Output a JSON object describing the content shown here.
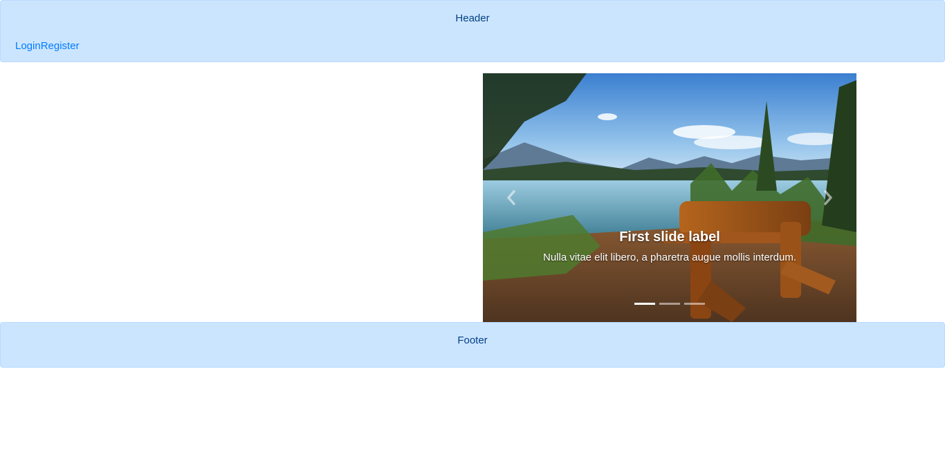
{
  "header": {
    "title": "Header",
    "nav": {
      "login_label": "Login",
      "register_label": "Register"
    }
  },
  "carousel": {
    "active_index": 0,
    "slide_count": 3,
    "slides": [
      {
        "caption_title": "First slide label",
        "caption_text": "Nulla vitae elit libero, a pharetra augue mollis interdum."
      }
    ],
    "prev_icon": "chevron-left-icon",
    "next_icon": "chevron-right-icon"
  },
  "footer": {
    "title": "Footer"
  },
  "colors": {
    "panel_bg": "#cce5ff",
    "panel_border": "#b8daff",
    "panel_text": "#004085",
    "link": "#007bff"
  }
}
